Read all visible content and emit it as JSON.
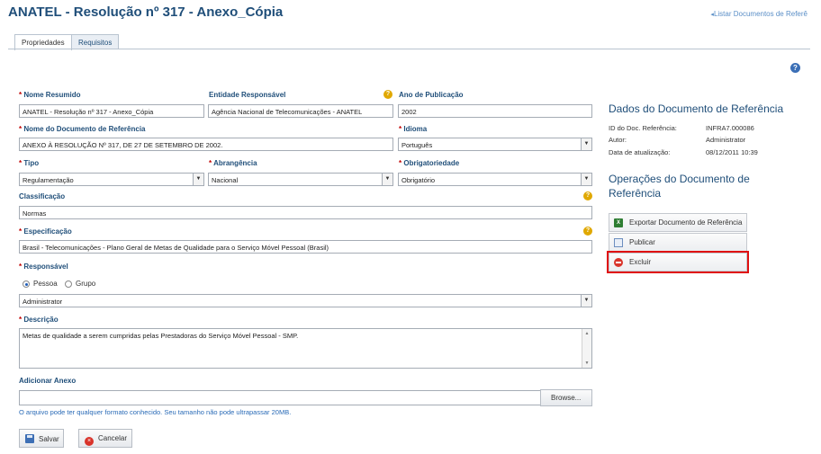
{
  "header": {
    "title": "ANATEL - Resolução nº 317 - Anexo_Cópia",
    "back_link": "Listar Documentos de Referê"
  },
  "tabs": [
    {
      "label": "Propriedades",
      "active": true
    },
    {
      "label": "Requisitos",
      "active": false
    }
  ],
  "form": {
    "nome_resumido": {
      "label": "Nome Resumido",
      "value": "ANATEL - Resolução nº 317 - Anexo_Cópia"
    },
    "entidade": {
      "label": "Entidade Responsável",
      "value": "Agência Nacional de Telecomunicações - ANATEL"
    },
    "ano": {
      "label": "Ano de Publicação",
      "value": "2002"
    },
    "nome_doc": {
      "label": "Nome do Documento de Referência",
      "value": "ANEXO À RESOLUÇÃO Nº 317, DE 27 DE SETEMBRO DE 2002."
    },
    "idioma": {
      "label": "Idioma",
      "value": "Português"
    },
    "tipo": {
      "label": "Tipo",
      "value": "Regulamentação"
    },
    "abrangencia": {
      "label": "Abrangência",
      "value": "Nacional"
    },
    "obrigatoriedade": {
      "label": "Obrigatoriedade",
      "value": "Obrigatório"
    },
    "classificacao": {
      "label": "Classificação",
      "value": "Normas"
    },
    "especificacao": {
      "label": "Especificação",
      "value": "Brasil - Telecomunicações - Plano Geral de Metas de Qualidade para o Serviço Móvel Pessoal (Brasil)"
    },
    "responsavel": {
      "label": "Responsável",
      "option_pessoa": "Pessoa",
      "option_grupo": "Grupo",
      "selected": "Pessoa",
      "value": "Administrator"
    },
    "descricao": {
      "label": "Descrição",
      "value": "Metas de qualidade a serem cumpridas pelas Prestadoras do Serviço Móvel Pessoal - SMP."
    },
    "anexo": {
      "label": "Adicionar Anexo",
      "browse_label": "Browse...",
      "hint": "O arquivo pode ter qualquer formato conhecido. Seu tamanho não pode ultrapassar 20MB."
    },
    "required_mark": "*",
    "save_label": "Salvar",
    "cancel_label": "Cancelar"
  },
  "side": {
    "dados_title": "Dados do Documento de Referência",
    "id_key": "ID do Doc. Referência:",
    "id_value": "INFRA7.000086",
    "autor_key": "Autor:",
    "autor_value": "Administrator",
    "data_key": "Data de atualização:",
    "data_value": "08/12/2011 10:39",
    "operacoes_title_1": "Operações do Documento de",
    "operacoes_title_2": "Referência",
    "op_exportar": "Exportar Documento de Referência",
    "op_publicar": "Publicar",
    "op_excluir": "Excluir"
  },
  "colors": {
    "title": "#1f4e79",
    "highlight": "#e01010",
    "link": "#2a6bb7"
  }
}
